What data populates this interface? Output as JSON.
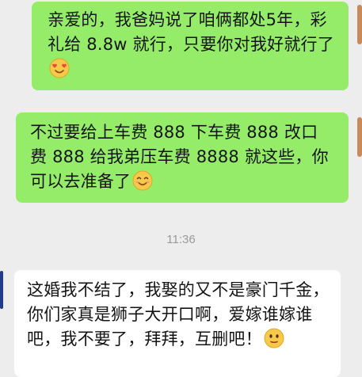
{
  "colors": {
    "background": "#ededed",
    "sent_bubble": "#95ec69",
    "received_bubble": "#ffffff",
    "timestamp_text": "#9a9a9a"
  },
  "messages": [
    {
      "direction": "sent",
      "text": "亲爱的，我爸妈说了咱俩都处5年，彩礼给 8.8w 就行，只要你对我好就行了",
      "emoji": "smiling-heart-eyes-emoji"
    },
    {
      "direction": "sent",
      "text": "不过要给上车费 888 下车费 888 改口费 888 给我弟压车费 8888 就这些，你可以去准备了",
      "emoji": "smiling-face-emoji"
    },
    {
      "direction": "received",
      "text": "这婚我不结了，我娶的又不是豪门千金，你们家真是狮子大开口啊，爱嫁谁嫁谁吧，我不要了，拜拜，互删吧！",
      "emoji": "neutral-face-emoji"
    }
  ],
  "timestamp": "11:36"
}
